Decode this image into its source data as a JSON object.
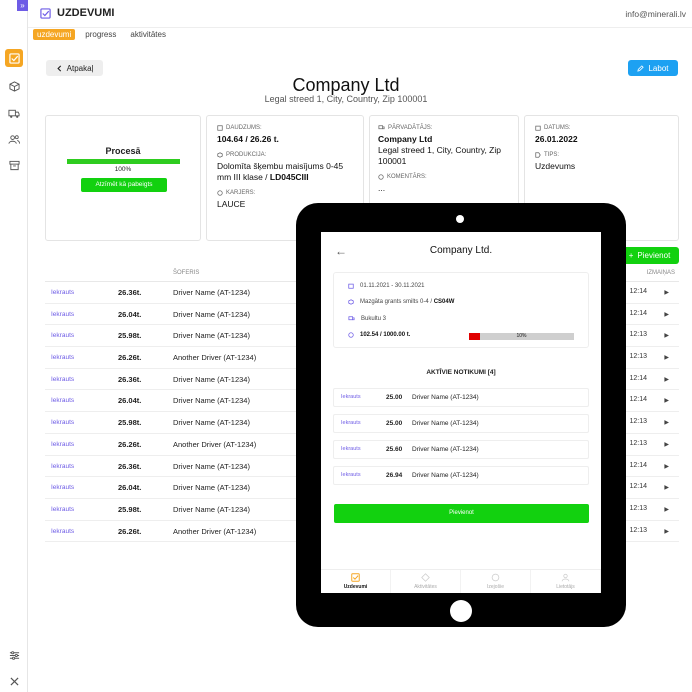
{
  "app": {
    "title": "UZDEVUMI",
    "email": "info@minerali.lv"
  },
  "tabs": [
    {
      "label": "uzdevumi",
      "active": true
    },
    {
      "label": "progress",
      "active": false
    },
    {
      "label": "aktivitātes",
      "active": false
    }
  ],
  "header": {
    "back_label": "Atpakaļ",
    "edit_label": "Labot",
    "company_name": "Company Ltd",
    "company_address": "Legal streed 1, City, Country, Zip 100001"
  },
  "status_card": {
    "status": "Procesā",
    "progress_pct": 100,
    "progress_label": "100%",
    "done_button": "Atzīmēt kā pabeigts"
  },
  "card_quantity": {
    "quantity_label": "DAUDZUMS:",
    "quantity_value": "104.64 / 26.26 t.",
    "product_label": "PRODUKCIJA:",
    "product_value": "Dolomīta šķembu maisījums 0-45 mm III klase / ",
    "product_code": "LD045CIII",
    "quarry_label": "KARJERS:",
    "quarry_value": "LAUCE"
  },
  "card_carrier": {
    "carrier_label": "PĀRVADĀTĀJS:",
    "carrier_name": "Company Ltd",
    "carrier_address": "Legal streed 1, City, Country, Zip 100001",
    "comment_label": "KOMENTĀRS:",
    "comment_value": "..."
  },
  "card_date": {
    "date_label": "DATUMS:",
    "date_value": "26.01.2022",
    "type_label": "TIPS:",
    "type_value": "Uzdevums"
  },
  "add_button": "Pievienot",
  "table": {
    "headers": {
      "driver": "ŠOFERIS",
      "changes": "IZMAIŅAS"
    },
    "rows": [
      {
        "status": "Iekrauts",
        "amount": "26.36t.",
        "driver": "Driver Name (AT-1234)",
        "time": "12:14"
      },
      {
        "status": "Iekrauts",
        "amount": "26.04t.",
        "driver": "Driver Name (AT-1234)",
        "time": "12:14"
      },
      {
        "status": "Iekrauts",
        "amount": "25.98t.",
        "driver": "Driver Name (AT-1234)",
        "time": "12:13"
      },
      {
        "status": "Iekrauts",
        "amount": "26.26t.",
        "driver": "Another Driver (AT-1234)",
        "time": "12:13"
      },
      {
        "status": "Iekrauts",
        "amount": "26.36t.",
        "driver": "Driver Name (AT-1234)",
        "time": "12:14"
      },
      {
        "status": "Iekrauts",
        "amount": "26.04t.",
        "driver": "Driver Name (AT-1234)",
        "time": "12:14"
      },
      {
        "status": "Iekrauts",
        "amount": "25.98t.",
        "driver": "Driver Name (AT-1234)",
        "time": "12:13"
      },
      {
        "status": "Iekrauts",
        "amount": "26.26t.",
        "driver": "Another Driver (AT-1234)",
        "time": "12:13"
      },
      {
        "status": "Iekrauts",
        "amount": "26.36t.",
        "driver": "Driver Name (AT-1234)",
        "time": "12:14"
      },
      {
        "status": "Iekrauts",
        "amount": "26.04t.",
        "driver": "Driver Name (AT-1234)",
        "time": "12:14"
      },
      {
        "status": "Iekrauts",
        "amount": "25.98t.",
        "driver": "Driver Name (AT-1234)",
        "time": "12:13"
      },
      {
        "status": "Iekrauts",
        "amount": "26.26t.",
        "driver": "Another Driver (AT-1234)",
        "time": "12:13"
      }
    ]
  },
  "tablet": {
    "title": "Company Ltd.",
    "date_range": "01.11.2021  -  30.11.2021",
    "product": "Mazgāta grants smilts 0-4 / ",
    "product_code": "CS04W",
    "location": "Bukultu 3",
    "quantity": "102.54 / 1000.00 t.",
    "progress_pct": 10,
    "progress_label": "10%",
    "events_title": "AKTĪVIE NOTIKUMI [4]",
    "events": [
      {
        "status": "Iekrauts",
        "amount": "25.00",
        "driver": "Driver Name (AT-1234)"
      },
      {
        "status": "Iekrauts",
        "amount": "25.00",
        "driver": "Driver Name (AT-1234)"
      },
      {
        "status": "Iekrauts",
        "amount": "25.60",
        "driver": "Driver Name (AT-1234)"
      },
      {
        "status": "Iekrauts",
        "amount": "26.94",
        "driver": "Driver Name (AT-1234)"
      }
    ],
    "add_button": "Pievienot",
    "nav": [
      {
        "label": "Uzdevumi",
        "active": true
      },
      {
        "label": "Aktivitātes",
        "active": false
      },
      {
        "label": "Izejošie",
        "active": false
      },
      {
        "label": "Lietotājs",
        "active": false
      }
    ]
  },
  "colors": {
    "accent": "#f5a623",
    "primary": "#1da1f2",
    "success": "#12d10f",
    "link": "#6e5ce6",
    "danger": "#e00000"
  }
}
